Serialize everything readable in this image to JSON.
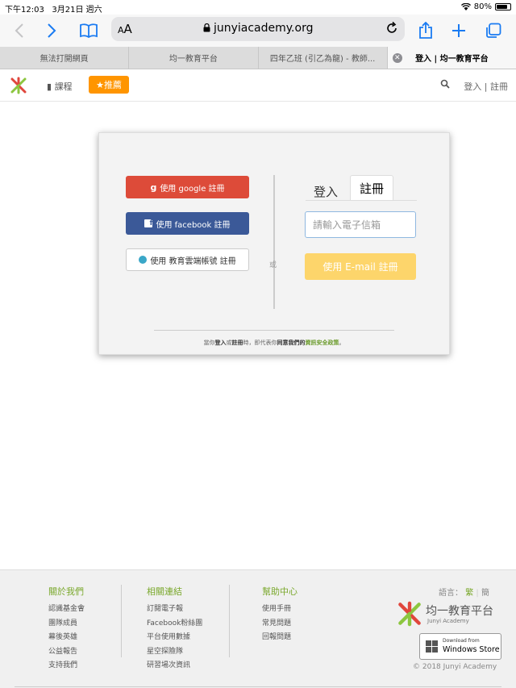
{
  "status": {
    "time": "下午12:03",
    "date": "3月21日 週六",
    "battery": "80%",
    "battery_level": 0.8
  },
  "toolbar": {
    "aa_label": "AA",
    "url": "junyiacademy.org"
  },
  "tabs": [
    {
      "title": "無法打開網頁"
    },
    {
      "title": "均一教育平台"
    },
    {
      "title": "四年乙班 (引乙為龍) - 教師..."
    },
    {
      "title": "登入 | 均一教育平台"
    }
  ],
  "sitenav": {
    "course_label": "課程",
    "recommend_label": "推薦",
    "login_label": "登入 | 註冊"
  },
  "signup": {
    "google_label": "使用 google 註冊",
    "facebook_label": "使用 facebook 註冊",
    "edu_label": "使用 教育雲端帳號 註冊",
    "or_label": "或",
    "tab_login": "登入",
    "tab_register": "註冊",
    "email_placeholder": "請輸入電子信箱",
    "email_button": "使用 E-mail 註冊",
    "terms_1": "當你",
    "terms_2": "登入",
    "terms_3": "或",
    "terms_4": "註冊",
    "terms_5": "時，即代表你",
    "terms_6": "同意我們的",
    "terms_link": "資訊安全政策",
    "terms_7": "。"
  },
  "footer": {
    "about": {
      "title": "關於我們",
      "items": [
        "認識基金會",
        "團隊成員",
        "幕後英雄",
        "公益報告",
        "支持我們"
      ]
    },
    "related": {
      "title": "相關連結",
      "items": [
        "訂閱電子報",
        "Facebook粉絲團",
        "平台使用數據",
        "星空探險隊",
        "研習場次資訊"
      ]
    },
    "help": {
      "title": "幫助中心",
      "items": [
        "使用手冊",
        "常見問題",
        "回報問題"
      ]
    },
    "lang_label": "語言：",
    "lang_trad": "繁",
    "lang_simp": "簡",
    "brand_cn": "均一教育平台",
    "brand_en": "Junyi Academy",
    "store_small": "Download from",
    "store_big": "Windows Store",
    "copyright": "© 2018 Junyi Academy"
  },
  "colors": {
    "accent_blue": "#1a7bf2",
    "google": "#dd4b39",
    "facebook": "#3b5998",
    "orange": "#ff9500",
    "email_btn": "#fdd56b",
    "green": "#7aa82c"
  }
}
